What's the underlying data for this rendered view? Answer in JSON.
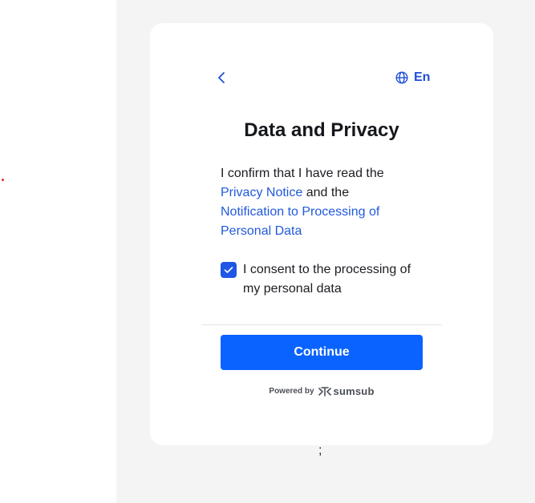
{
  "language": {
    "label": "En",
    "icon": "globe-icon"
  },
  "back": {
    "icon": "chevron-left-icon"
  },
  "title": "Data and Privacy",
  "intro": {
    "prefix": "I confirm that I have read the",
    "privacy_link": "Privacy Notice",
    "middle": "and the",
    "notification_link": "Notification to Processing of Personal Data"
  },
  "consent": {
    "label": "I consent to the processing of my personal data",
    "checked": true
  },
  "continue_label": "Continue",
  "footer": {
    "powered_by": "Powered by",
    "brand": "sumsub"
  },
  "stray_text": ";",
  "colors": {
    "accent": "#0b63ff",
    "link": "#2159dc",
    "checkbox": "#1f56e6",
    "page_bg": "#f4f4f5",
    "card_bg": "#ffffff"
  }
}
